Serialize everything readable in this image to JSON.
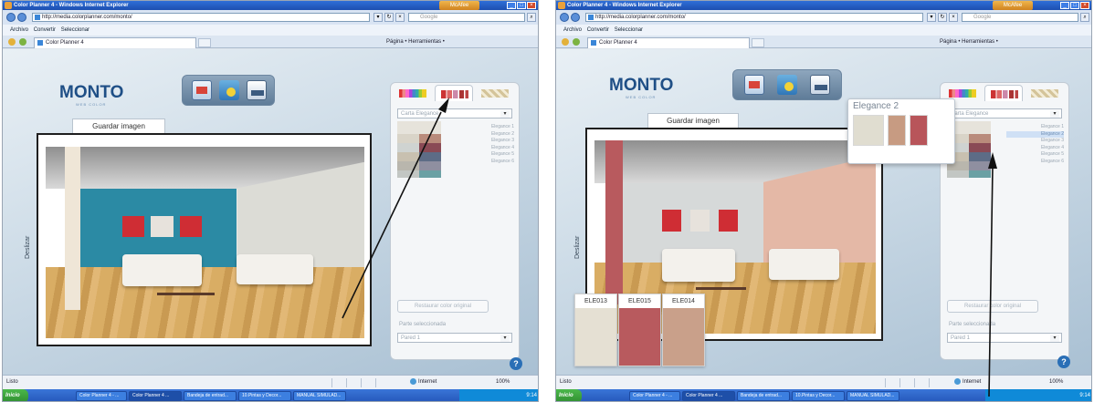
{
  "browser": {
    "window_title": "Color Planner 4 - Windows Internet Explorer",
    "mcafee": "McAfee",
    "url": "http://media.colorplanner.com/monto/",
    "search_placeholder": "Google",
    "menu_archivo": "Archivo",
    "menu_convertir": "Convertir",
    "menu_seleccionar": "Seleccionar",
    "tab_title": "Color Planner 4",
    "tools_label": "Página • Herramientas •",
    "status_left": "Listo",
    "status_zone": "Internet",
    "zoom": "100%"
  },
  "app": {
    "brand": "MONTO",
    "brand_sub": "WEB COLOR",
    "save_image": "Guardar imagen",
    "slider_label": "Deslizar",
    "restore_button": "Restaurar color original",
    "parts_label": "Parte seleccionada",
    "part_value": "Pared 1",
    "help": "?"
  },
  "left": {
    "collection_select": "Carta Elegance",
    "palette_items": [
      "Elegance 1",
      "Elegance 2",
      "Elegance 3",
      "Elegance 4",
      "Elegance 5",
      "Elegance 6"
    ],
    "colors": {
      "back_wall": "#2b8aa4",
      "right_wall": "#dcdcd6",
      "column": "#efe6d7"
    }
  },
  "right": {
    "collection_select": "Carta Elegance",
    "palette_items": [
      "Elegance 1",
      "Elegance 2",
      "Elegance 3",
      "Elegance 4",
      "Elegance 5",
      "Elegance 6"
    ],
    "popup_title": "Elegance 2",
    "popup_swatches": [
      "#e0ddd0",
      "#c79b82",
      "#b8555a"
    ],
    "chips": [
      {
        "code": "ELE013",
        "color": "#e5e0d3"
      },
      {
        "code": "ELE015",
        "color": "#b85a5e"
      },
      {
        "code": "ELE014",
        "color": "#c9a08a"
      }
    ],
    "colors": {
      "back_wall": "#d6d9d9",
      "right_wall": "#e4b8a6",
      "column": "#b85a5e"
    }
  },
  "taskbar": {
    "start": "Inicio",
    "tasks": [
      "Color Planner 4 - ...",
      "Color Planner 4 ...",
      "Bandeja de entrad...",
      "10.Pintas y Decor...",
      "MANUAL SIMULAD..."
    ],
    "clock": "9:14"
  }
}
